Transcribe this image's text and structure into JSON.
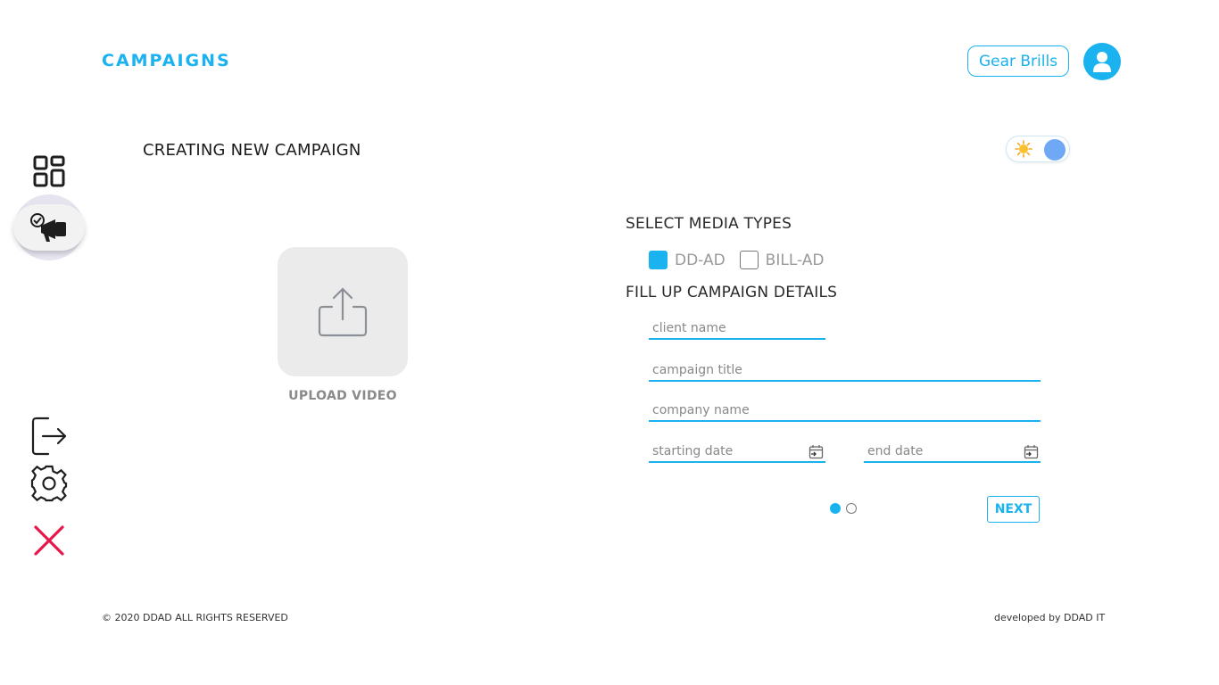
{
  "header": {
    "title": "CAMPAIGNS",
    "user_name": "Gear Brills",
    "avatar_icon": "user-icon"
  },
  "sidebar": {
    "items": [
      {
        "name": "dashboard",
        "icon": "grid-icon",
        "active": false
      },
      {
        "name": "campaigns",
        "icon": "megaphone-icon",
        "active": true
      },
      {
        "name": "logout",
        "icon": "logout-icon",
        "active": false
      },
      {
        "name": "settings",
        "icon": "gear-icon",
        "active": false
      },
      {
        "name": "close",
        "icon": "close-icon",
        "active": false
      }
    ]
  },
  "main": {
    "page_title": "CREATING NEW CAMPAIGN",
    "theme_toggle": {
      "icon": "sun-icon",
      "state": "light"
    },
    "upload": {
      "label": "UPLOAD VIDEO",
      "icon": "upload-icon"
    },
    "media_section": {
      "heading": "SELECT MEDIA TYPES",
      "options": [
        {
          "label": "DD-AD",
          "checked": true
        },
        {
          "label": "BILL-AD",
          "checked": false
        }
      ]
    },
    "details_section": {
      "heading": "FILL UP CAMPAIGN DETAILS",
      "fields": {
        "client_name": {
          "placeholder": "client name",
          "value": ""
        },
        "campaign_title": {
          "placeholder": "campaign title",
          "value": ""
        },
        "company_name": {
          "placeholder": "company name",
          "value": ""
        },
        "starting_date": {
          "placeholder": "starting date",
          "value": ""
        },
        "end_date": {
          "placeholder": "end date",
          "value": ""
        }
      }
    },
    "pagination": {
      "current": 1,
      "total": 2
    },
    "next_label": "NEXT"
  },
  "footer": {
    "copyright": "© 2020 DDAD ALL RIGHTS RESERVED",
    "developer": "developed by DDAD IT"
  },
  "colors": {
    "accent": "#1ab2ef",
    "danger": "#e8174a",
    "toggle_knob": "#6fa8f4"
  }
}
